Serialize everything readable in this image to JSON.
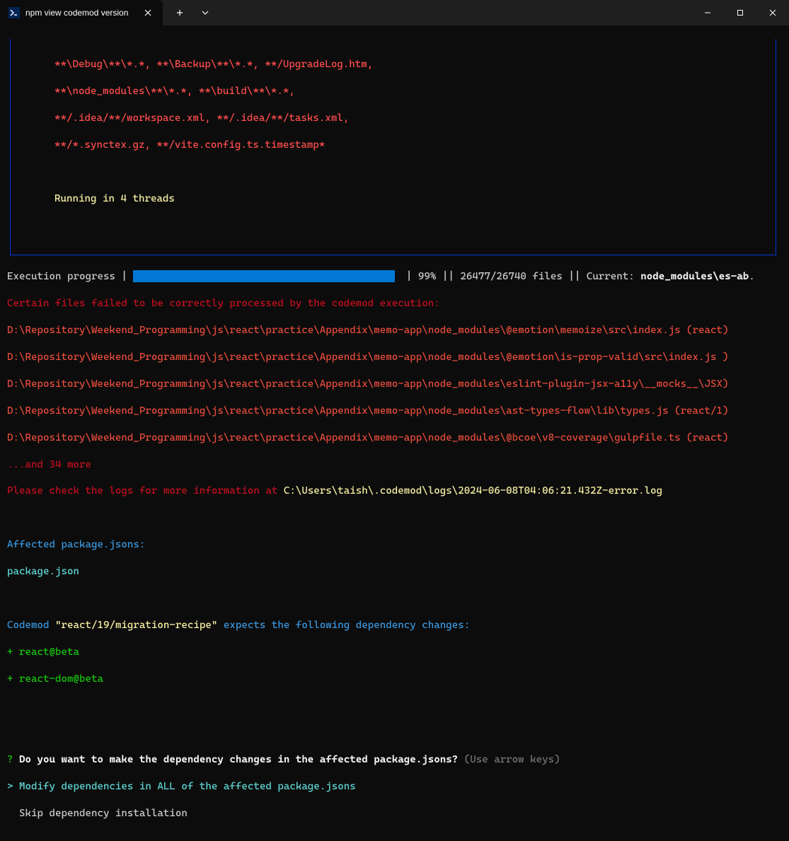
{
  "titlebar": {
    "tab_title": "npm view codemod version"
  },
  "box": {
    "l1": "**\\Debug\\**\\*.*, **\\Backup\\**\\*.*, **/UpgradeLog.htm,",
    "l2": "**\\node_modules\\**\\*.*, **\\build\\**\\*.*,",
    "l3": "**/.idea/**/workspace.xml, **/.idea/**/tasks.xml,",
    "l4": "**/*.synctex.gz, **/vite.config.ts.timestamp*",
    "threads": "Running in 4 threads"
  },
  "progress": {
    "label": "Execution progress",
    "sep1": " | ",
    "after_bar": " | 99% || 26477/26740 files || Current: ",
    "current_file": "node_modules\\es-ab",
    "dot": "."
  },
  "errors": {
    "header": "Certain files failed to be correctly processed by the codemod execution:",
    "lines": [
      "D:\\Repository\\Weekend_Programming\\js\\react\\practice\\Appendix\\memo-app\\node_modules\\@emotion\\memoize\\src\\index.js (react)",
      "D:\\Repository\\Weekend_Programming\\js\\react\\practice\\Appendix\\memo-app\\node_modules\\@emotion\\is-prop-valid\\src\\index.js )",
      "D:\\Repository\\Weekend_Programming\\js\\react\\practice\\Appendix\\memo-app\\node_modules\\eslint-plugin-jsx-a11y\\__mocks__\\JSX)",
      "D:\\Repository\\Weekend_Programming\\js\\react\\practice\\Appendix\\memo-app\\node_modules\\ast-types-flow\\lib\\types.js (react/1)",
      "D:\\Repository\\Weekend_Programming\\js\\react\\practice\\Appendix\\memo-app\\node_modules\\@bcoe\\v8-coverage\\gulpfile.ts (react)"
    ],
    "more": "...and 34 more",
    "check_prefix": "Please check the logs for more information at ",
    "check_path": "C:\\Users\\taish\\.codemod\\logs\\2024-06-08T04:06:21.432Z-error.log"
  },
  "affected": {
    "header": "Affected package.jsons:",
    "file": "package.json"
  },
  "codemod": {
    "prefix": "Codemod ",
    "name": "\"react/19/migration-recipe\"",
    "suffix": " expects the following dependency changes:",
    "dep1": "+ react@beta",
    "dep2": "+ react-dom@beta"
  },
  "prompt": {
    "qmark": "?",
    "question": " Do you want to make the dependency changes in the affected package.jsons? ",
    "hint": "(Use arrow keys)",
    "caret": ">",
    "opt1": " Modify dependencies in ALL of the affected package.jsons",
    "opt2": "  Skip dependency installation"
  }
}
